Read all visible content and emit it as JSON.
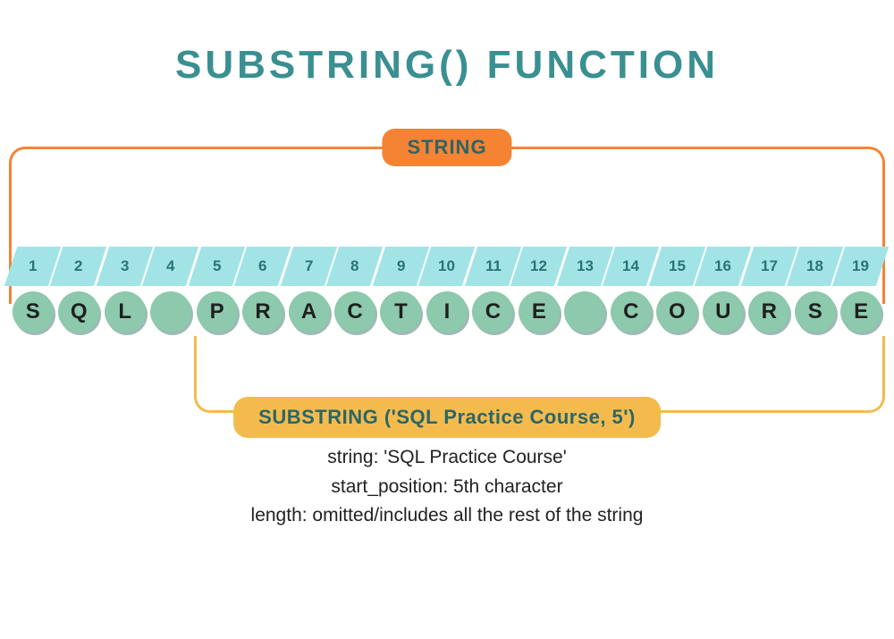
{
  "title": "SUBSTRING() FUNCTION",
  "string_label": "STRING",
  "indices": [
    "1",
    "2",
    "3",
    "4",
    "5",
    "6",
    "7",
    "8",
    "9",
    "10",
    "11",
    "12",
    "13",
    "14",
    "15",
    "16",
    "17",
    "18",
    "19"
  ],
  "chars": [
    "S",
    "Q",
    "L",
    "",
    "P",
    "R",
    "A",
    "C",
    "T",
    "I",
    "C",
    "E",
    "",
    "C",
    "O",
    "U",
    "R",
    "S",
    "E"
  ],
  "substring_label": "SUBSTRING ('SQL Practice Course, 5')",
  "notes": {
    "line1": "string: 'SQL Practice Course'",
    "line2": "start_position: 5th character",
    "line3": "length: omitted/includes all the rest of the string"
  },
  "colors": {
    "title": "#3a8f91",
    "orange": "#f58334",
    "cyan": "#a2e4e6",
    "green": "#8cc9ad",
    "yellow": "#f3bb4e"
  }
}
